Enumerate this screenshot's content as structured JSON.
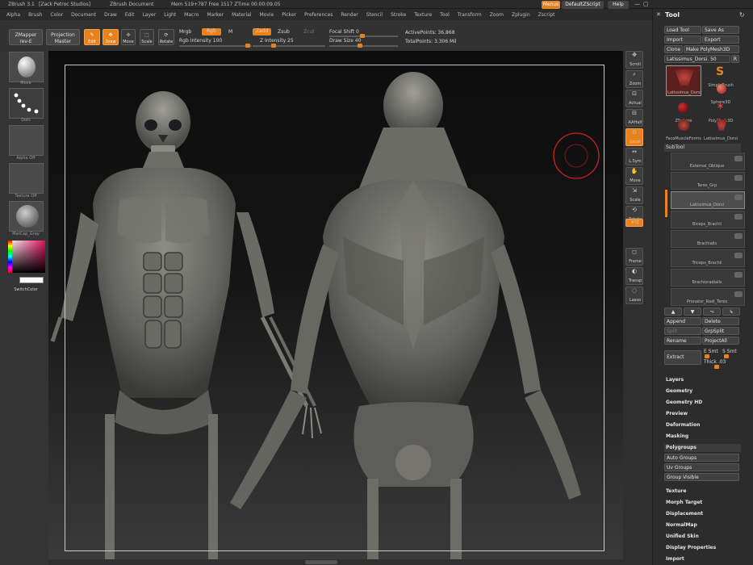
{
  "title_bar": {
    "app": "ZBrush 3.1",
    "author": "[Zack Petroc Studios]",
    "document": "ZBrush Document",
    "stats": "Mem 519+787 Free 1517 ZTime 00:00:09.05",
    "menus_btn": "Menus",
    "script": "DefaultZScript",
    "help": "Help"
  },
  "menu": [
    "Alpha",
    "Brush",
    "Color",
    "Document",
    "Draw",
    "Edit",
    "Layer",
    "Light",
    "Macro",
    "Marker",
    "Material",
    "Movie",
    "Picker",
    "Preferences",
    "Render",
    "Stencil",
    "Stroke",
    "Texture",
    "Tool",
    "Transform",
    "Zoom",
    "Zplugin",
    "Zscript"
  ],
  "shelf": {
    "zmapper": "ZMapper",
    "zmapper_sub": "rev-E",
    "projection": "Projection",
    "projection_sub": "Master",
    "edit": "Edit",
    "draw": "Draw",
    "move": "Move",
    "scale": "Scale",
    "rotate": "Rotate",
    "mrgb": "Mrgb",
    "rgb": "Rgb",
    "m": "M",
    "rgb_intensity": "Rgb Intensity 100",
    "zadd": "Zadd",
    "zsub": "Zsub",
    "zcut": "Zcut",
    "z_intensity": "Z Intensity 25",
    "focal_shift": "Focal Shift 0",
    "draw_size": "Draw Size 40",
    "active_points": "ActivePoints: 36,868",
    "total_points": "TotalPoints: 3.306 Mil"
  },
  "left_tray": {
    "brush": "Move",
    "stroke": "Dots",
    "alpha": "Alpha Off",
    "texture": "Texture Off",
    "material": "MatCap_Gray",
    "switch_color": "SwitchColor"
  },
  "view_tools": [
    "Scroll",
    "Zoom",
    "Actual",
    "AAHalf",
    "Local",
    "L.Sym",
    "Move",
    "Scale",
    "Rotate",
    "XYZ",
    "Frame",
    "Transp",
    "Lasso"
  ],
  "panel": {
    "title": "Tool",
    "load_tool": "Load Tool",
    "save_as": "Save As",
    "import": "Import",
    "export": "Export",
    "clone": "Clone",
    "make_polymesh": "Make PolyMesh3D",
    "current_tool": "Latissimus_Dorsi. 50",
    "r": "R",
    "tools": [
      {
        "name": "Latissimus_Dorsi"
      },
      {
        "name": "SimpleBrush"
      },
      {
        "name": "Sphere3D"
      },
      {
        "name": "ZSphere"
      },
      {
        "name": "PolyMesh3D"
      },
      {
        "name": "FaceMuscleForms"
      },
      {
        "name": "Latissimus_Dorsi"
      }
    ],
    "subtool_header": "SubTool",
    "subtools": [
      "External_Oblique",
      "Teres_Grp",
      "Latissimus_Dorsi",
      "Biceps_Brachii",
      "Brachialis",
      "Triceps_Brachii",
      "Brachioradialis",
      "Pronator_Radi_Teres"
    ],
    "append": "Append",
    "delete": "Delete",
    "split": "Split",
    "grpsplit": "GrpSplit",
    "rename": "Rename",
    "projectall": "ProjectAll",
    "extract": "Extract",
    "esmt": "E Smt",
    "ssmt": "S Smt",
    "thick": "Thick .03",
    "sections_a": [
      "Layers",
      "Geometry",
      "Geometry HD",
      "Preview",
      "Deformation",
      "Masking",
      "Polygroups"
    ],
    "polygroup_buttons": [
      "Auto Groups",
      "Uv Groups",
      "Group Visible"
    ],
    "sections_b": [
      "Texture",
      "Morph Target",
      "Displacement",
      "NormalMap",
      "Unified Skin",
      "Display Properties",
      "Import"
    ]
  },
  "colors": {
    "accent": "#e8821c",
    "panel": "#2c2c2c",
    "viewport_top": "#0d0d0d"
  }
}
